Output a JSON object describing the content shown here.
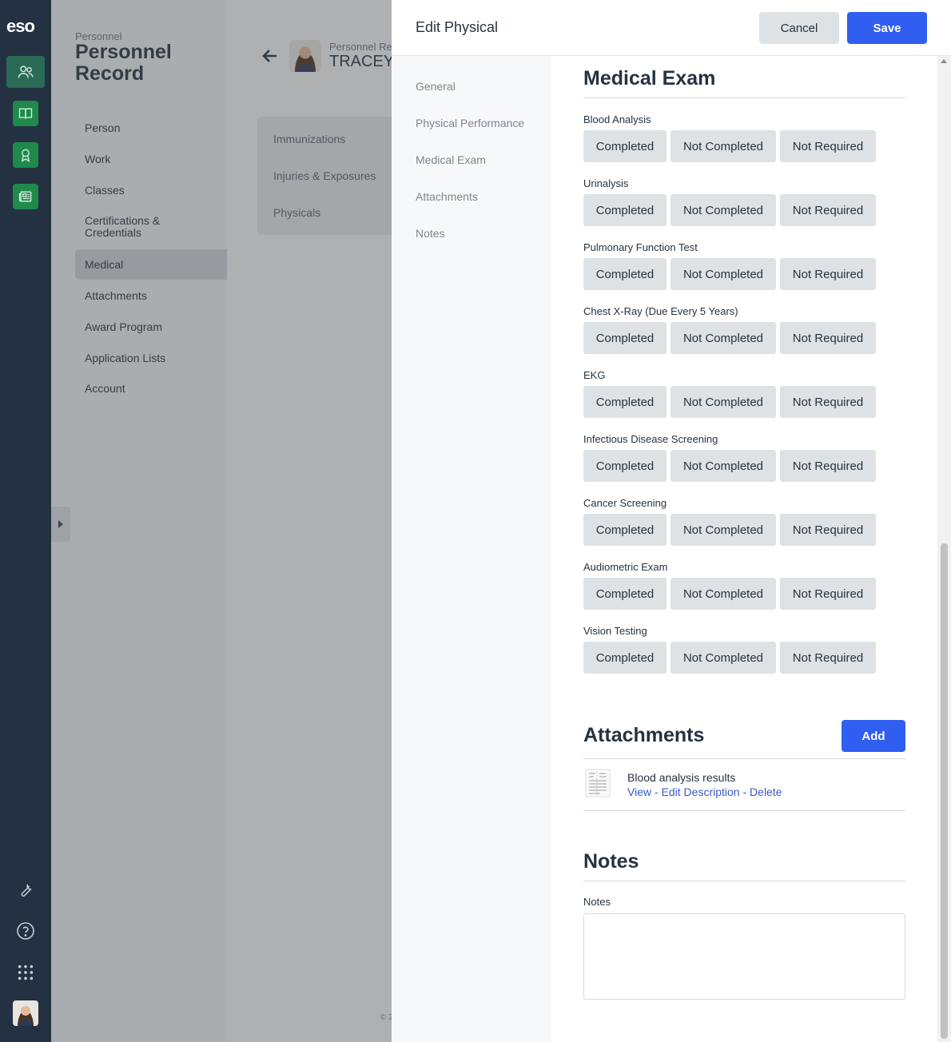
{
  "rail": {
    "logo": "eso",
    "apps": [
      "personnel-icon",
      "book-icon",
      "award-icon",
      "news-icon"
    ],
    "tools": [
      "wrench-icon",
      "help-icon",
      "apps-grid-icon"
    ]
  },
  "background": {
    "breadcrumb_small": "Personnel",
    "page_title": "Personnel Record",
    "nav_items": [
      "Person",
      "Work",
      "Classes",
      "Certifications & Credentials",
      "Medical",
      "Attachments",
      "Award Program",
      "Application Lists",
      "Account"
    ],
    "active_nav": "Medical",
    "record_label": "Personnel Re",
    "record_name": "TRACEY",
    "subnav": [
      "Immunizations",
      "Injuries & Exposures",
      "Physicals"
    ],
    "copyright": "© 2"
  },
  "modal": {
    "title": "Edit Physical",
    "cancel_label": "Cancel",
    "save_label": "Save",
    "side_nav": [
      "General",
      "Physical Performance",
      "Medical Exam",
      "Attachments",
      "Notes"
    ],
    "medical_exam": {
      "title": "Medical Exam",
      "options": [
        "Completed",
        "Not Completed",
        "Not Required"
      ],
      "fields": [
        "Blood Analysis",
        "Urinalysis",
        "Pulmonary Function Test",
        "Chest X-Ray (Due Every 5 Years)",
        "EKG",
        "Infectious Disease Screening",
        "Cancer Screening",
        "Audiometric Exam",
        "Vision Testing"
      ]
    },
    "attachments": {
      "title": "Attachments",
      "add_label": "Add",
      "items": [
        {
          "name": "Blood analysis results",
          "view": "View",
          "edit": "Edit Description",
          "delete": "Delete",
          "separator": " - "
        }
      ]
    },
    "notes": {
      "title": "Notes",
      "label": "Notes",
      "value": ""
    }
  },
  "colors": {
    "rail": "#243142",
    "app_green": "#1f8a4c",
    "primary_blue": "#2f5ef0",
    "link_blue": "#3a5bc7",
    "segment_gray": "#dfe2e5"
  }
}
